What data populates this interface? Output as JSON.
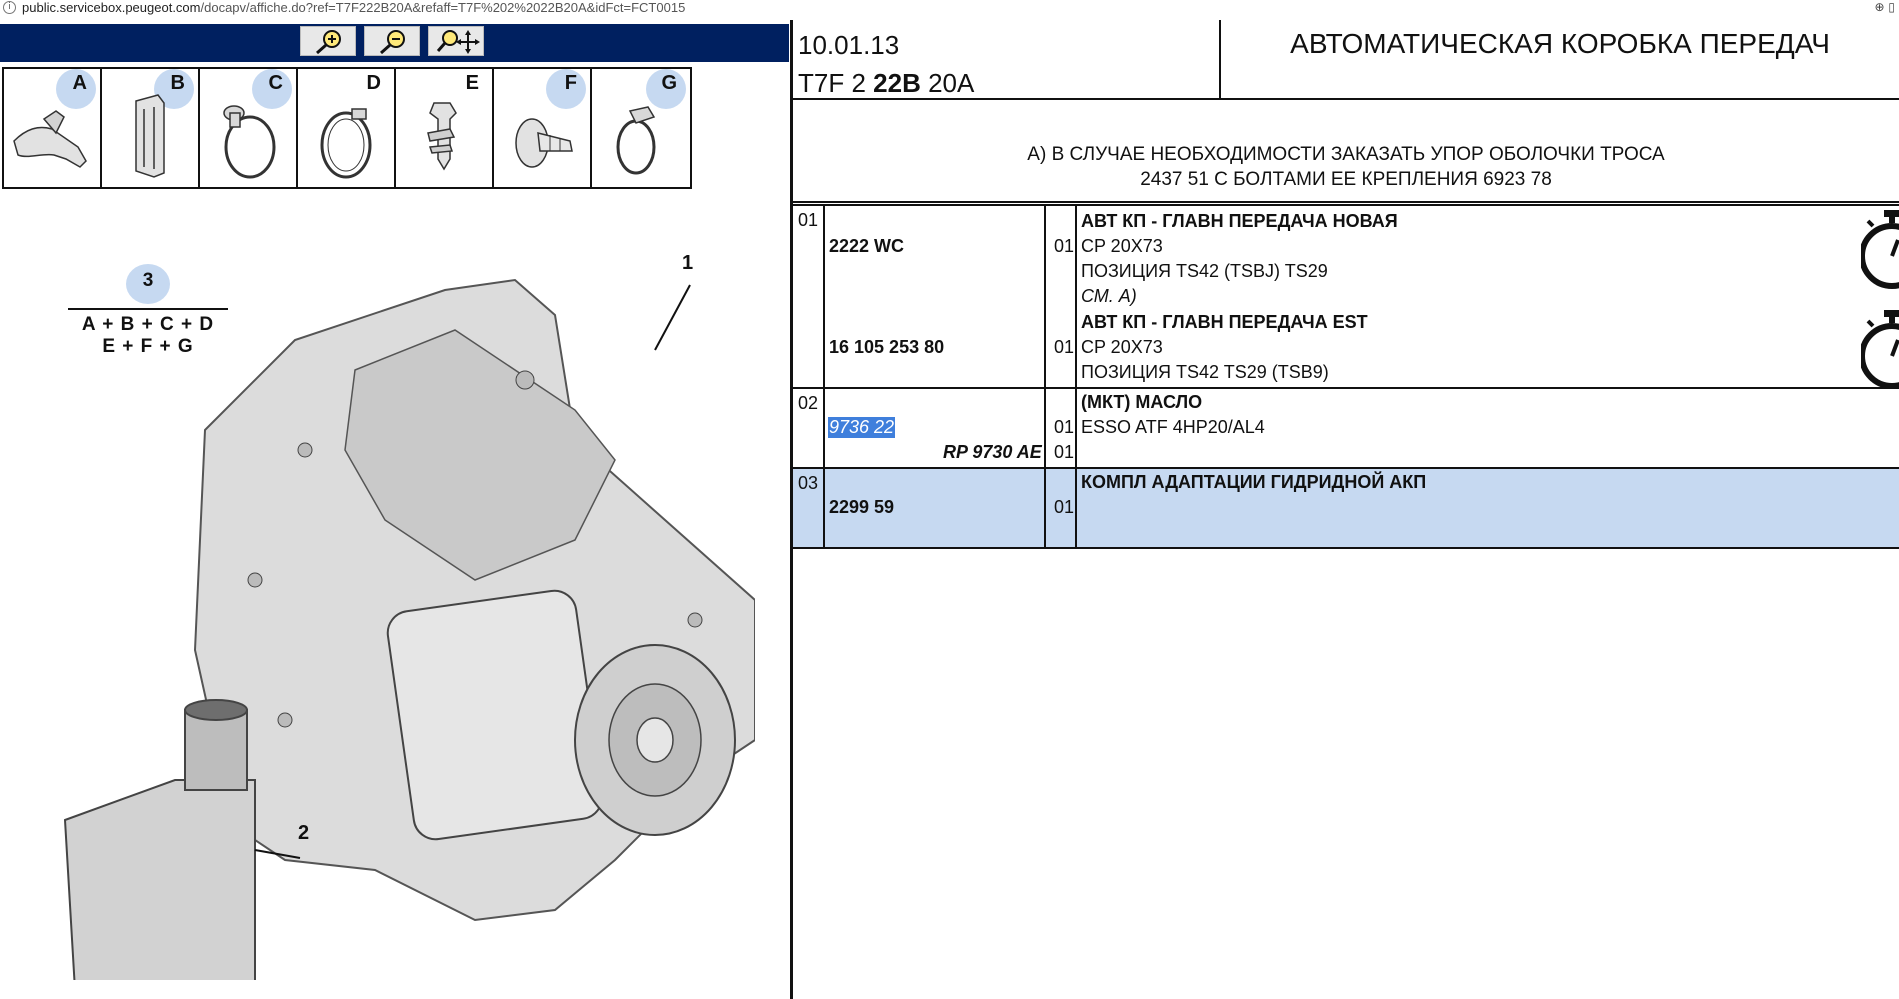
{
  "browser": {
    "url_host": "public.servicebox.peugeot.com",
    "url_path": "/docapv/affiche.do?ref=T7F222B20A&refaff=T7F%202%2022B20A&idFct=FCT0015"
  },
  "clip_labels": [
    "A",
    "B",
    "C",
    "D",
    "E",
    "F",
    "G"
  ],
  "formula": {
    "number": "3",
    "line1": "A + B + C + D",
    "line2": "E + F + G"
  },
  "callouts": [
    "1",
    "2"
  ],
  "header": {
    "date": "10.01.13",
    "code_prefix": "T7F 2",
    "code_bold": "22B",
    "code_suffix": "20A",
    "title": "АВТОМАТИЧЕСКАЯ КОРОБКА ПЕРЕДАЧ"
  },
  "note": {
    "line1": "А) В СЛУЧАЕ НЕОБХОДИМОСТИ ЗАКАЗАТЬ УПОР ОБОЛОЧКИ ТРОСА",
    "line2": "2437 51 С БОЛТАМИ ЕЕ КРЕПЛЕНИЯ 6923 78"
  },
  "parts": [
    {
      "pos": "01",
      "items": [
        {
          "ref": "2222 WC",
          "qty": "01",
          "title": "АВТ КП - ГЛАВН ПЕРЕДАЧА НОВАЯ",
          "lines": [
            "CP 20X73",
            "ПОЗИЦИЯ TS42 (TSBJ) TS29"
          ],
          "note": "СМ. А)"
        },
        {
          "ref": "16 105 253 80",
          "qty": "01",
          "title": "АВТ КП - ГЛАВН ПЕРЕДАЧА EST",
          "lines": [
            "CP 20X73",
            "ПОЗИЦИЯ TS42 TS29 (TSB9)"
          ]
        }
      ]
    },
    {
      "pos": "02",
      "ref": "9736 22",
      "ref2": "RP 9730 AE",
      "qty": "01",
      "qty2": "01",
      "title": "(МКТ) МАСЛО",
      "line": "ESSO ATF 4HP20/AL4"
    },
    {
      "pos": "03",
      "ref": "2299 59",
      "qty": "01",
      "title": "КОМПЛ АДАПТАЦИИ ГИДРИДНОЙ АКП"
    }
  ]
}
